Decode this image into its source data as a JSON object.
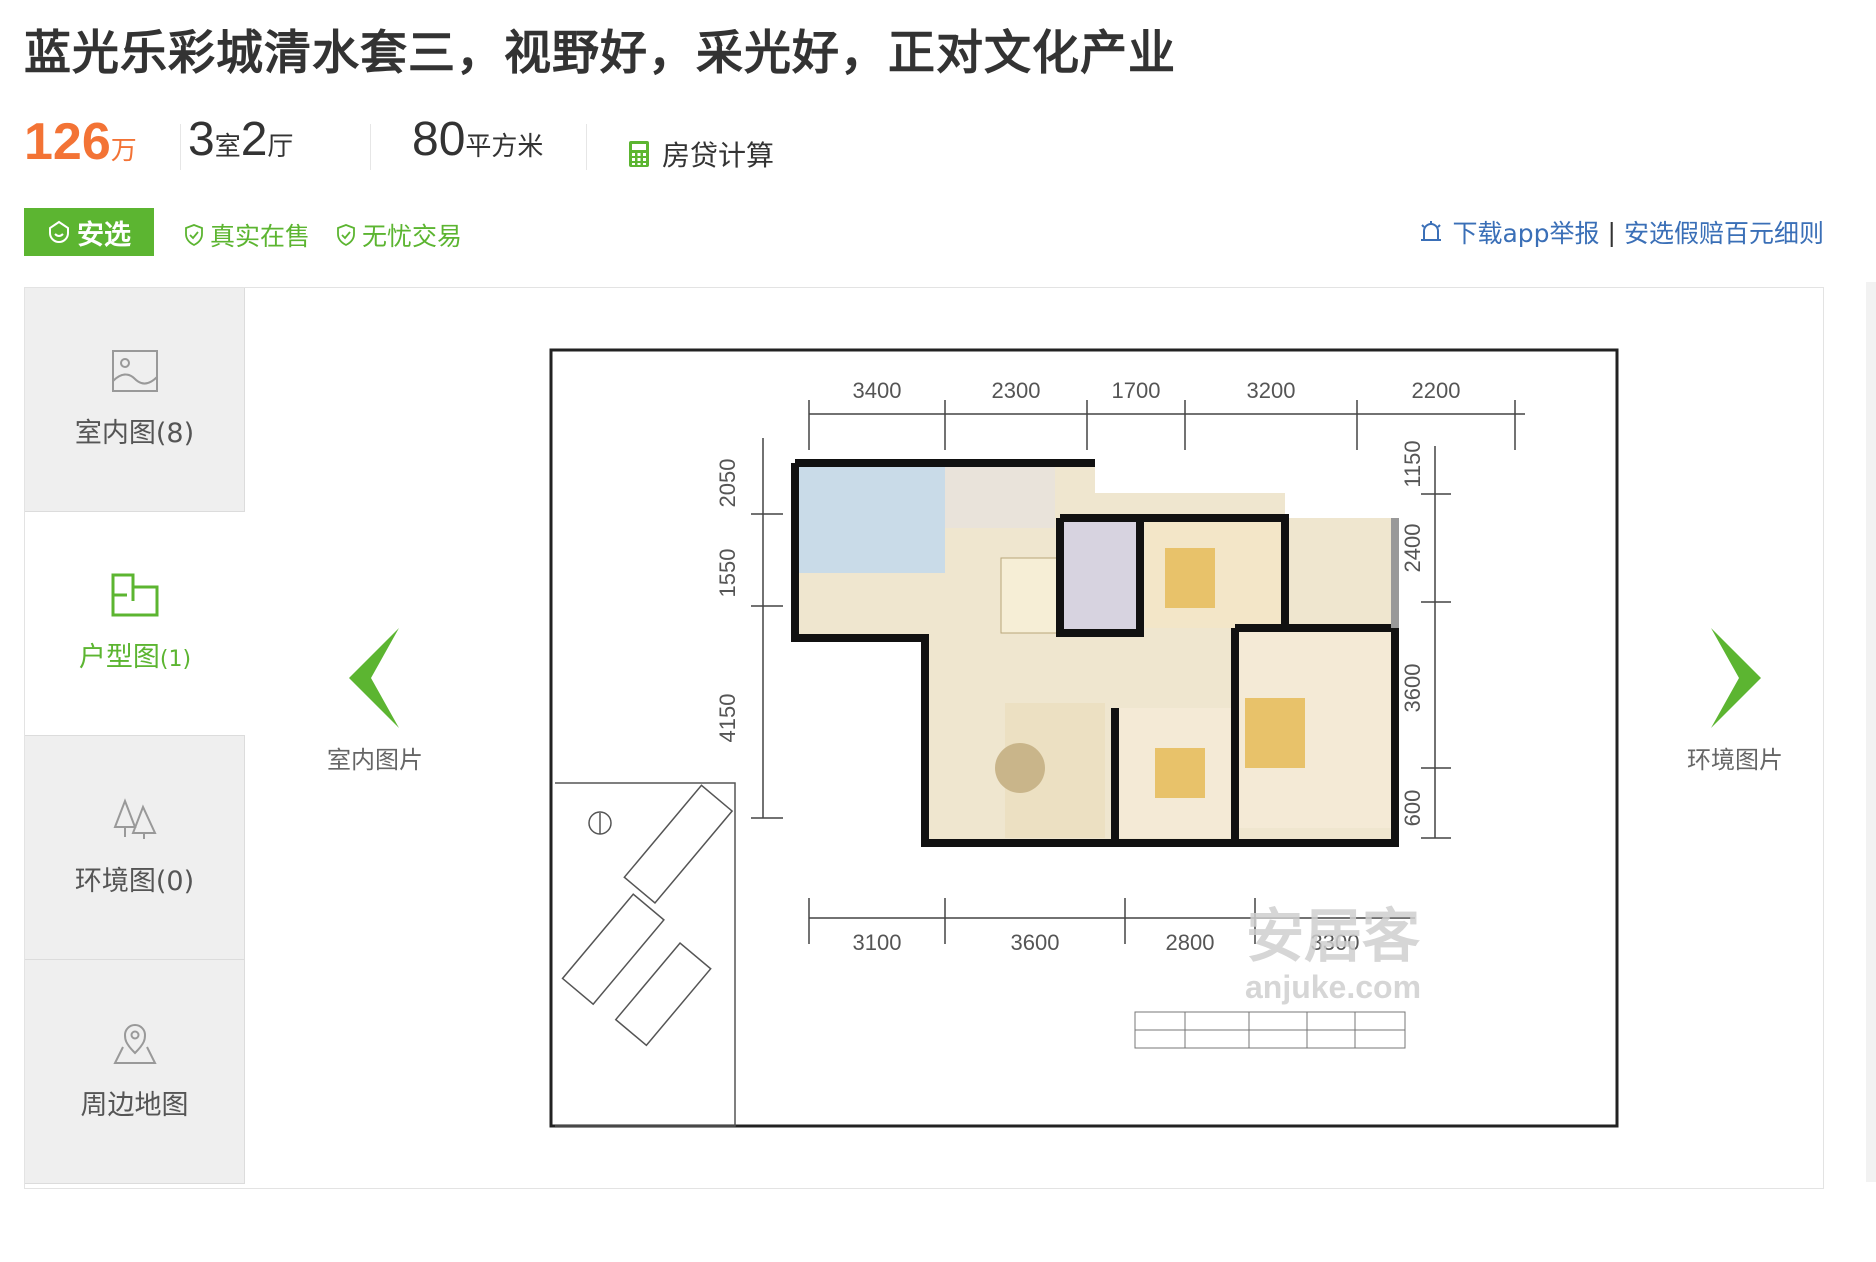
{
  "listing": {
    "title": "蓝光乐彩城清水套三，视野好，采光好，正对文化产业",
    "price_value": "126",
    "price_unit": "万",
    "rooms_num": "3",
    "rooms_unit": "室",
    "halls_num": "2",
    "halls_unit": "厅",
    "area_value": "80",
    "area_unit": "平方米",
    "calc_label": "房贷计算"
  },
  "badges": {
    "anxuan": "安选",
    "real": "真实在售",
    "worry_free": "无忧交易"
  },
  "report": {
    "download": "下载app举报",
    "separator": "|",
    "compensation": "安选假赔百元细则"
  },
  "gallery": {
    "tabs": [
      {
        "label": "室内图(8)",
        "icon": "image-icon",
        "active": false
      },
      {
        "label": "户型图",
        "count": "(1)",
        "icon": "floorplan-icon",
        "active": true
      },
      {
        "label": "环境图(0)",
        "icon": "trees-icon",
        "active": false
      },
      {
        "label": "周边地图",
        "icon": "map-pin-icon",
        "active": false
      }
    ],
    "prev_label": "室内图片",
    "next_label": "环境图片",
    "watermark_cn": "安居客",
    "watermark_en": "anjuke.com",
    "dims_top": [
      "3400",
      "2300",
      "1700",
      "3200",
      "2200"
    ],
    "dims_bottom": [
      "3100",
      "3600",
      "2800",
      "3300"
    ],
    "dims_left": [
      "2050",
      "1550",
      "4150"
    ],
    "dims_right": [
      "1150",
      "2400",
      "3600",
      "600"
    ]
  },
  "colors": {
    "accent_green": "#5cb531",
    "price_orange": "#f37335",
    "link_blue": "#3a6fb7"
  }
}
